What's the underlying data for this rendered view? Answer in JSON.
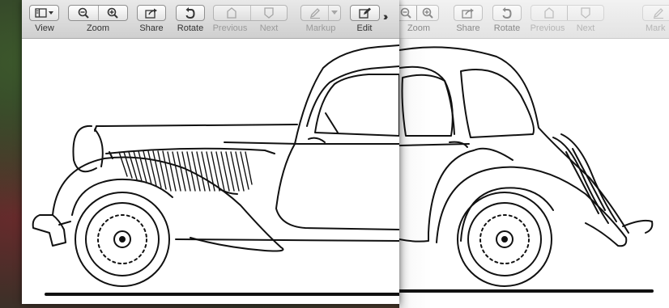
{
  "toolbar": {
    "view": "View",
    "zoom": "Zoom",
    "share": "Share",
    "rotate": "Rotate",
    "previous": "Previous",
    "next": "Next",
    "markup": "Markup",
    "edit": "Edit"
  },
  "back_toolbar": {
    "zoom": "Zoom",
    "share": "Share",
    "rotate": "Rotate",
    "previous": "Previous",
    "next": "Next",
    "markup": "Mark"
  },
  "icons": {
    "view": "sidebar-view-icon",
    "zoom_out": "zoom-out-icon",
    "zoom_in": "zoom-in-icon",
    "share": "share-icon",
    "rotate": "rotate-icon",
    "previous": "previous-page-icon",
    "next": "next-page-icon",
    "markup": "markup-pen-icon",
    "edit": "edit-icon",
    "overflow": "toolbar-overflow-icon"
  },
  "document": {
    "content": "line drawing of a vintage car (side view)"
  }
}
